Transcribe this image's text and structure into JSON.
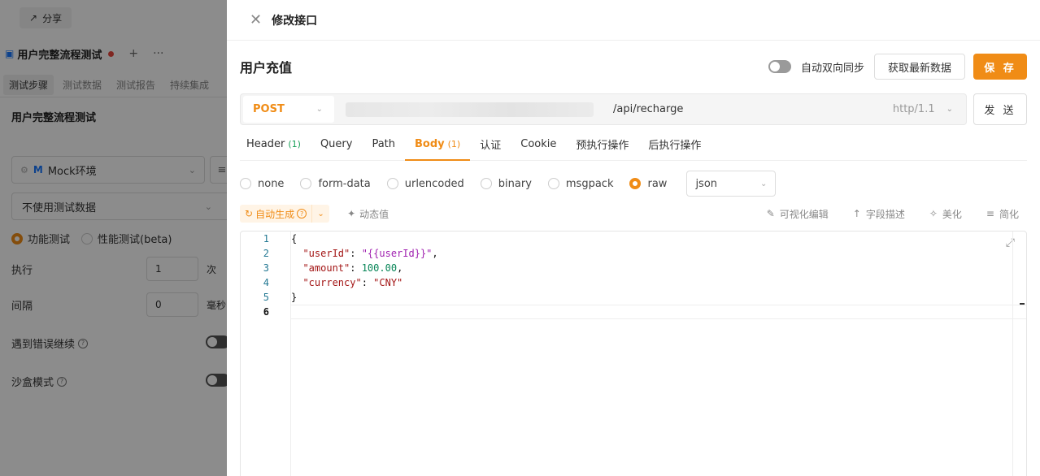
{
  "background": {
    "share_label": "分享",
    "doc_tab_label": "用户完整流程测试",
    "plus": "+",
    "more": "···",
    "subtabs": [
      "测试步骤",
      "测试数据",
      "测试报告",
      "持续集成"
    ],
    "flow_title": "用户完整流程测试",
    "env_badge": "M",
    "env_label": "Mock环境",
    "test_data_select": "不使用测试数据",
    "mode_functional": "功能测试",
    "mode_performance": "性能测试(beta)",
    "exec_label": "执行",
    "exec_value": "1",
    "exec_unit": "次",
    "interval_label": "间隔",
    "interval_value": "0",
    "interval_unit": "毫秒",
    "continue_on_error": "遇到错误继续",
    "sandbox_mode": "沙盒模式"
  },
  "drawer": {
    "title": "修改接口",
    "api_name": "用户充值",
    "sync_label": "自动双向同步",
    "fetch_label": "获取最新数据",
    "save_label": "保 存",
    "method": "POST",
    "path": "/api/recharge",
    "http_version": "http/1.1",
    "send_label": "发 送",
    "tabs": [
      {
        "label": "Header",
        "count": "(1)"
      },
      {
        "label": "Query",
        "count": ""
      },
      {
        "label": "Path",
        "count": ""
      },
      {
        "label": "Body",
        "count": "(1)"
      },
      {
        "label": "认证",
        "count": ""
      },
      {
        "label": "Cookie",
        "count": ""
      },
      {
        "label": "预执行操作",
        "count": ""
      },
      {
        "label": "后执行操作",
        "count": ""
      }
    ],
    "body_types": [
      "none",
      "form-data",
      "urlencoded",
      "binary",
      "msgpack",
      "raw"
    ],
    "raw_format": "json",
    "auto_generate": "自动生成",
    "dynamic_value": "动态值",
    "tools": [
      "可视化编辑",
      "字段描述",
      "美化",
      "简化"
    ],
    "line_numbers": [
      "1",
      "2",
      "3",
      "4",
      "5",
      "6"
    ],
    "code": {
      "open": "{",
      "k1": "\"userId\"",
      "v1": "\"{{userId}}\"",
      "k2": "\"amount\"",
      "v2": "100.00",
      "k3": "\"currency\"",
      "v3": "\"CNY\"",
      "close": "}"
    }
  }
}
